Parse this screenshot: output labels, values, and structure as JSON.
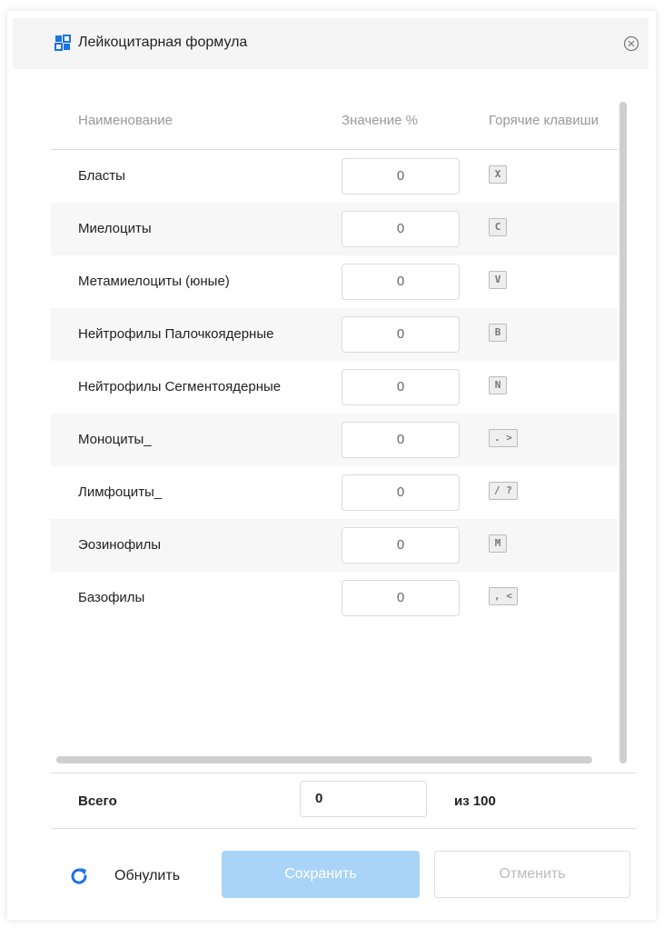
{
  "dialog": {
    "title": "Лейкоцитарная формула"
  },
  "table": {
    "columns": {
      "name": "Наименование",
      "value": "Значение %",
      "keys": "Горячие клавиши"
    },
    "rows": [
      {
        "name": "Бласты",
        "value": "0",
        "hotkey": "X"
      },
      {
        "name": "Миелоциты",
        "value": "0",
        "hotkey": "C"
      },
      {
        "name": "Метамиелоциты (юные)",
        "value": "0",
        "hotkey": "V"
      },
      {
        "name": "Нейтрофилы Палочкоядерные",
        "value": "0",
        "hotkey": "B"
      },
      {
        "name": "Нейтрофилы Сегментоядерные",
        "value": "0",
        "hotkey": "N"
      },
      {
        "name": "Моноциты_",
        "value": "0",
        "hotkey": ". >"
      },
      {
        "name": "Лимфоциты_",
        "value": "0",
        "hotkey": "/ ?"
      },
      {
        "name": "Эозинофилы",
        "value": "0",
        "hotkey": "M"
      },
      {
        "name": "Базофилы",
        "value": "0",
        "hotkey": ", <"
      }
    ]
  },
  "total": {
    "label": "Всего",
    "value": "0",
    "of_label": "из 100"
  },
  "footer": {
    "reset_label": "Обнулить",
    "save_label": "Сохранить",
    "cancel_label": "Отменить"
  },
  "colors": {
    "accent": "#1a73e8",
    "save_disabled": "#a9d4f7"
  }
}
